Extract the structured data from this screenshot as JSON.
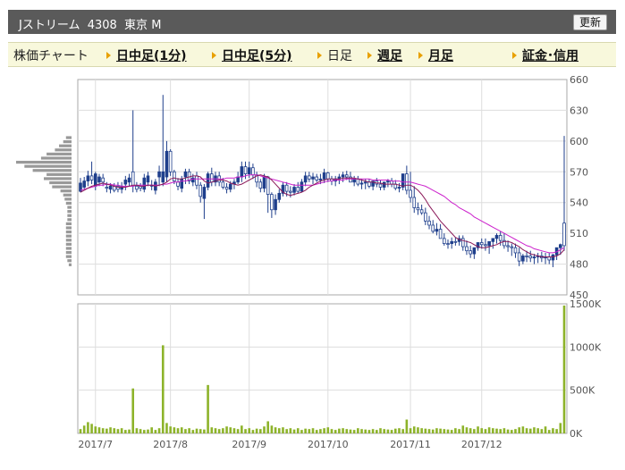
{
  "header": {
    "title": "Jストリーム  4308  東京 M",
    "refresh_label": "更新"
  },
  "nav": {
    "chart_label": "株価チャート",
    "items": [
      {
        "label": "日中足(1分)",
        "link": true
      },
      {
        "label": "日中足(5分)",
        "link": true
      },
      {
        "label": "日足",
        "link": false
      },
      {
        "label": "週足",
        "link": true
      },
      {
        "label": "月足",
        "link": true
      },
      {
        "label": "証金･信用",
        "link": true
      }
    ]
  },
  "colors": {
    "up": "#ffffff",
    "down": "#1f3f8c",
    "ma_short": "#8b1a5a",
    "ma_long": "#cc22cc",
    "volume": "#8db32a",
    "profile": "#999999",
    "grid": "#dddddd"
  },
  "chart_data": {
    "type": "candlestick",
    "x_labels": [
      "2017/7",
      "2017/8",
      "2017/9",
      "2017/10",
      "2017/11",
      "2017/12"
    ],
    "label_day_index": [
      4,
      24,
      45,
      66,
      88,
      107
    ],
    "price_axis": {
      "ticks": [
        450,
        480,
        510,
        540,
        570,
        600,
        630,
        660
      ],
      "ylim": [
        450,
        660
      ]
    },
    "volume_axis": {
      "ticks": [
        "0K",
        "500K",
        "1000K",
        "1500K"
      ],
      "tick_values": [
        0,
        500,
        1000,
        1500
      ],
      "ylim": [
        0,
        1500
      ]
    },
    "close": [
      551,
      555,
      561,
      566,
      556,
      560,
      564,
      555,
      553,
      556,
      556,
      553,
      558,
      560,
      570,
      556,
      556,
      553,
      560,
      556,
      552,
      565,
      560,
      565,
      590,
      570,
      560,
      554,
      565,
      570,
      560,
      566,
      557,
      544,
      555,
      568,
      560,
      566,
      560,
      555,
      553,
      558,
      560,
      565,
      575,
      568,
      574,
      567,
      560,
      554,
      565,
      548,
      533,
      543,
      549,
      557,
      551,
      550,
      555,
      551,
      560,
      566,
      563,
      565,
      562,
      563,
      569,
      563,
      561,
      563,
      565,
      567,
      565,
      560,
      563,
      558,
      559,
      560,
      556,
      561,
      558,
      555,
      560,
      561,
      558,
      554,
      555,
      568,
      552,
      545,
      535,
      533,
      530,
      522,
      518,
      512,
      514,
      505,
      500,
      500,
      502,
      502,
      505,
      497,
      493,
      490,
      496,
      501,
      499,
      498,
      502,
      505,
      508,
      503,
      498,
      497,
      496,
      491,
      483,
      488,
      488,
      486,
      487,
      488,
      486,
      487,
      484,
      489,
      496,
      520
    ],
    "open": [
      559,
      561,
      566,
      562,
      568,
      565,
      560,
      554,
      556,
      552,
      553,
      556,
      562,
      564,
      556,
      553,
      554,
      564,
      566,
      557,
      560,
      570,
      570,
      590,
      570,
      561,
      556,
      563,
      570,
      561,
      564,
      557,
      546,
      555,
      568,
      560,
      566,
      560,
      555,
      553,
      558,
      560,
      565,
      575,
      568,
      574,
      567,
      560,
      554,
      565,
      548,
      533,
      543,
      549,
      557,
      551,
      550,
      555,
      551,
      560,
      566,
      563,
      565,
      562,
      563,
      569,
      563,
      561,
      563,
      565,
      567,
      565,
      560,
      563,
      558,
      559,
      560,
      556,
      561,
      558,
      555,
      560,
      561,
      558,
      554,
      555,
      568,
      552,
      545,
      535,
      533,
      530,
      522,
      518,
      512,
      514,
      505,
      500,
      500,
      502,
      502,
      505,
      497,
      493,
      490,
      496,
      501,
      499,
      498,
      502,
      505,
      508,
      503,
      498,
      497,
      496,
      491,
      483,
      488,
      488,
      486,
      487,
      488,
      486,
      487,
      484,
      489,
      496,
      499,
      498
    ],
    "high": [
      564,
      565,
      571,
      580,
      570,
      568,
      568,
      560,
      559,
      559,
      560,
      560,
      566,
      568,
      630,
      560,
      559,
      568,
      570,
      562,
      563,
      576,
      645,
      600,
      592,
      572,
      564,
      566,
      573,
      573,
      568,
      570,
      560,
      558,
      570,
      574,
      570,
      570,
      564,
      559,
      561,
      563,
      570,
      580,
      580,
      580,
      578,
      570,
      563,
      568,
      566,
      550,
      548,
      553,
      560,
      560,
      556,
      558,
      560,
      563,
      570,
      570,
      569,
      568,
      568,
      573,
      570,
      566,
      566,
      568,
      570,
      571,
      570,
      566,
      566,
      563,
      563,
      563,
      560,
      564,
      562,
      560,
      563,
      564,
      562,
      559,
      560,
      576,
      570,
      556,
      540,
      538,
      535,
      527,
      523,
      520,
      519,
      510,
      504,
      506,
      506,
      508,
      508,
      503,
      498,
      495,
      500,
      505,
      505,
      502,
      505,
      510,
      512,
      510,
      503,
      500,
      500,
      496,
      490,
      493,
      493,
      490,
      491,
      492,
      491,
      491,
      490,
      493,
      500,
      605
    ],
    "low": [
      550,
      553,
      556,
      558,
      552,
      556,
      556,
      550,
      549,
      550,
      550,
      549,
      552,
      556,
      550,
      550,
      551,
      550,
      556,
      552,
      548,
      556,
      556,
      560,
      566,
      558,
      552,
      550,
      558,
      558,
      556,
      553,
      540,
      524,
      552,
      556,
      556,
      556,
      553,
      549,
      550,
      553,
      558,
      560,
      563,
      564,
      563,
      555,
      550,
      550,
      530,
      525,
      528,
      540,
      546,
      546,
      545,
      547,
      549,
      550,
      556,
      560,
      558,
      560,
      558,
      559,
      560,
      557,
      556,
      558,
      560,
      562,
      560,
      556,
      556,
      553,
      553,
      554,
      552,
      555,
      552,
      552,
      555,
      555,
      552,
      550,
      552,
      548,
      540,
      530,
      528,
      528,
      518,
      514,
      510,
      508,
      508,
      498,
      495,
      495,
      498,
      498,
      493,
      489,
      486,
      485,
      493,
      495,
      493,
      490,
      495,
      500,
      498,
      495,
      492,
      488,
      486,
      478,
      480,
      482,
      482,
      480,
      481,
      482,
      480,
      480,
      477,
      484,
      489,
      493
    ],
    "ma_short": [
      550,
      552,
      554,
      556,
      557,
      558,
      559,
      558,
      557,
      556,
      555,
      555,
      555,
      556,
      557,
      557,
      556,
      556,
      557,
      557,
      556,
      557,
      558,
      560,
      563,
      564,
      563,
      563,
      564,
      565,
      566,
      566,
      565,
      561,
      559,
      560,
      561,
      562,
      562,
      561,
      559,
      558,
      557,
      558,
      560,
      562,
      564,
      566,
      567,
      566,
      565,
      562,
      558,
      554,
      550,
      548,
      547,
      548,
      549,
      550,
      552,
      555,
      557,
      559,
      561,
      562,
      563,
      563,
      563,
      563,
      564,
      564,
      564,
      564,
      563,
      562,
      561,
      560,
      560,
      559,
      559,
      558,
      558,
      558,
      558,
      557,
      556,
      557,
      557,
      555,
      552,
      548,
      543,
      537,
      532,
      527,
      522,
      518,
      514,
      510,
      506,
      504,
      503,
      502,
      501,
      499,
      497,
      496,
      496,
      497,
      498,
      499,
      501,
      502,
      502,
      501,
      499,
      497,
      494,
      492,
      490,
      489,
      488,
      487,
      487,
      487,
      487,
      488,
      490,
      494
    ],
    "ma_long": [
      552,
      553,
      554,
      555,
      556,
      557,
      557,
      558,
      558,
      557,
      557,
      556,
      556,
      556,
      556,
      557,
      557,
      557,
      557,
      557,
      557,
      557,
      558,
      558,
      559,
      560,
      560,
      561,
      561,
      562,
      563,
      563,
      563,
      563,
      563,
      563,
      563,
      563,
      563,
      564,
      564,
      564,
      565,
      565,
      566,
      567,
      567,
      567,
      566,
      565,
      564,
      563,
      562,
      561,
      560,
      559,
      558,
      557,
      557,
      557,
      557,
      557,
      557,
      558,
      559,
      560,
      561,
      561,
      562,
      562,
      562,
      563,
      563,
      563,
      563,
      563,
      563,
      563,
      562,
      562,
      562,
      562,
      562,
      561,
      561,
      561,
      560,
      560,
      560,
      559,
      558,
      557,
      556,
      554,
      552,
      550,
      548,
      546,
      543,
      540,
      538,
      535,
      533,
      531,
      529,
      526,
      524,
      522,
      520,
      518,
      516,
      514,
      512,
      510,
      508,
      506,
      504,
      502,
      500,
      498,
      497,
      495,
      494,
      493,
      492,
      491,
      491,
      492,
      494,
      496
    ],
    "volume": [
      50,
      90,
      130,
      110,
      80,
      70,
      60,
      55,
      70,
      60,
      50,
      60,
      40,
      45,
      520,
      60,
      50,
      40,
      45,
      70,
      40,
      60,
      1020,
      120,
      80,
      70,
      60,
      70,
      50,
      60,
      40,
      55,
      50,
      45,
      560,
      70,
      60,
      50,
      60,
      80,
      70,
      60,
      50,
      90,
      50,
      60,
      40,
      55,
      50,
      80,
      140,
      90,
      70,
      60,
      70,
      50,
      60,
      45,
      60,
      40,
      55,
      50,
      60,
      40,
      50,
      60,
      70,
      50,
      40,
      55,
      60,
      50,
      45,
      40,
      60,
      50,
      45,
      40,
      50,
      40,
      60,
      50,
      45,
      40,
      55,
      60,
      50,
      160,
      60,
      80,
      70,
      60,
      55,
      50,
      45,
      60,
      55,
      50,
      45,
      40,
      60,
      50,
      90,
      70,
      60,
      50,
      80,
      60,
      50,
      70,
      60,
      55,
      50,
      60,
      45,
      40,
      50,
      70,
      80,
      60,
      55,
      70,
      60,
      50,
      80,
      40,
      60,
      50,
      120,
      1480
    ],
    "volume_profile": [
      {
        "price": 603,
        "volume": 4
      },
      {
        "price": 599,
        "volume": 6
      },
      {
        "price": 595,
        "volume": 9
      },
      {
        "price": 591,
        "volume": 12
      },
      {
        "price": 587,
        "volume": 18
      },
      {
        "price": 583,
        "volume": 22
      },
      {
        "price": 579,
        "volume": 40
      },
      {
        "price": 575,
        "volume": 34
      },
      {
        "price": 571,
        "volume": 28
      },
      {
        "price": 567,
        "volume": 18
      },
      {
        "price": 563,
        "volume": 20
      },
      {
        "price": 559,
        "volume": 16
      },
      {
        "price": 555,
        "volume": 14
      },
      {
        "price": 551,
        "volume": 8
      },
      {
        "price": 547,
        "volume": 6
      },
      {
        "price": 543,
        "volume": 5
      },
      {
        "price": 539,
        "volume": 4
      },
      {
        "price": 535,
        "volume": 3
      },
      {
        "price": 531,
        "volume": 3
      },
      {
        "price": 527,
        "volume": 3
      },
      {
        "price": 523,
        "volume": 3
      },
      {
        "price": 519,
        "volume": 4
      },
      {
        "price": 515,
        "volume": 4
      },
      {
        "price": 511,
        "volume": 4
      },
      {
        "price": 507,
        "volume": 4
      },
      {
        "price": 503,
        "volume": 4
      },
      {
        "price": 499,
        "volume": 4
      },
      {
        "price": 495,
        "volume": 4
      },
      {
        "price": 491,
        "volume": 4
      },
      {
        "price": 487,
        "volume": 4
      },
      {
        "price": 483,
        "volume": 3
      },
      {
        "price": 479,
        "volume": 2
      }
    ]
  }
}
